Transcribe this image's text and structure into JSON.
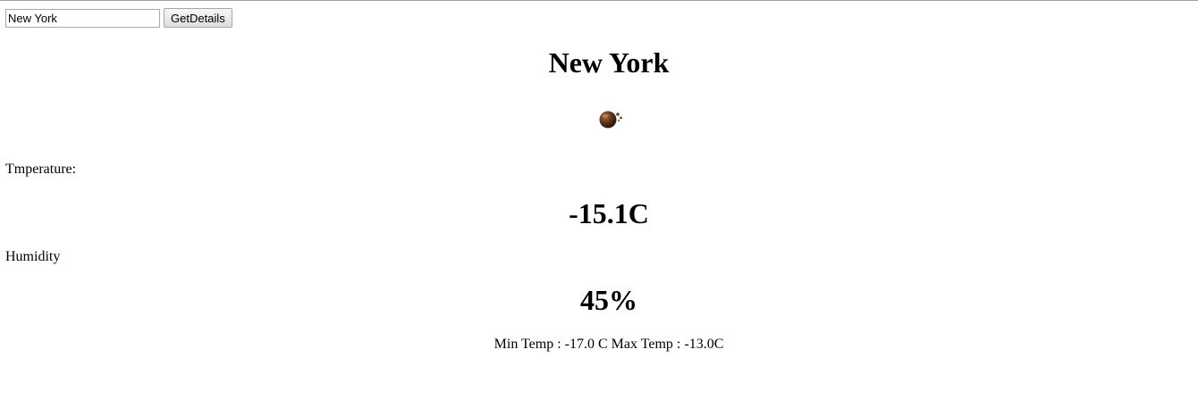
{
  "search": {
    "value": "New York",
    "button_label": "GetDetails"
  },
  "city": {
    "name": "New York",
    "icon": "weather-condition-icon"
  },
  "temperature": {
    "label": "Tmperature:",
    "value": "-15.1C"
  },
  "humidity": {
    "label": "Humidity",
    "value": "45%"
  },
  "range": {
    "text": "Min Temp : -17.0 C Max Temp : -13.0C"
  }
}
